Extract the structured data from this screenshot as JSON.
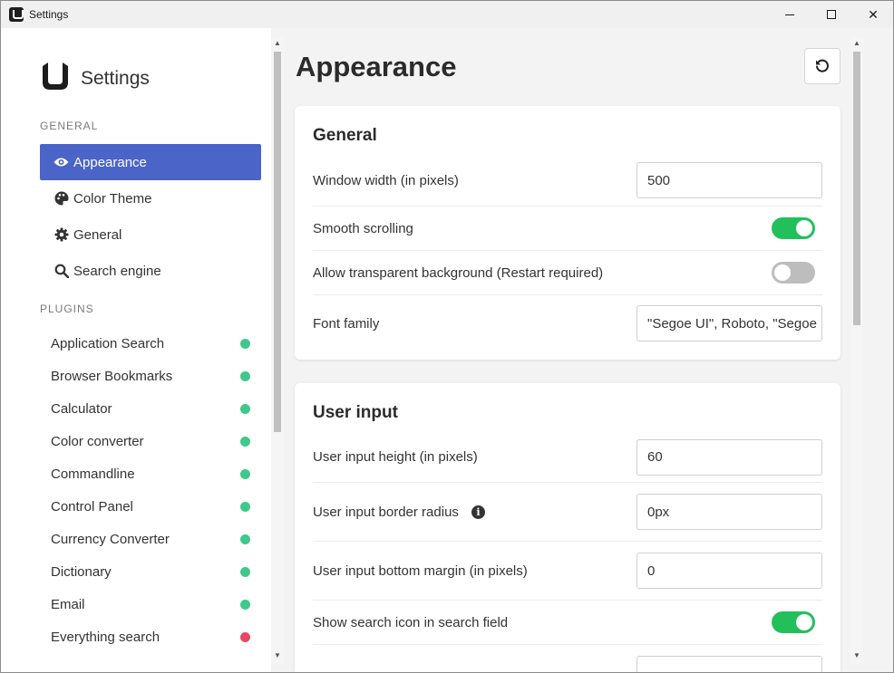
{
  "window": {
    "title": "Settings",
    "minimize_icon": "minimize-icon",
    "maximize_icon": "maximize-icon",
    "close_icon": "close-icon",
    "close_glyph": "✕"
  },
  "sidebar": {
    "brand_title": "Settings",
    "general_section": "GENERAL",
    "general_items": [
      {
        "label": "Appearance",
        "icon": "eye-icon",
        "active": true
      },
      {
        "label": "Color Theme",
        "icon": "palette-icon",
        "active": false
      },
      {
        "label": "General",
        "icon": "gear-icon",
        "active": false
      },
      {
        "label": "Search engine",
        "icon": "search-icon",
        "active": false
      }
    ],
    "plugins_section": "PLUGINS",
    "plugins": [
      {
        "label": "Application Search",
        "status": "enabled"
      },
      {
        "label": "Browser Bookmarks",
        "status": "enabled"
      },
      {
        "label": "Calculator",
        "status": "enabled"
      },
      {
        "label": "Color converter",
        "status": "enabled"
      },
      {
        "label": "Commandline",
        "status": "enabled"
      },
      {
        "label": "Control Panel",
        "status": "enabled"
      },
      {
        "label": "Currency Converter",
        "status": "enabled"
      },
      {
        "label": "Dictionary",
        "status": "enabled"
      },
      {
        "label": "Email",
        "status": "enabled"
      },
      {
        "label": "Everything search",
        "status": "disabled"
      }
    ]
  },
  "colors": {
    "accent": "#4b64c8",
    "toggle_on": "#22c05a",
    "toggle_off": "#bdbdbd",
    "status_enabled": "#3ec98a",
    "status_disabled": "#e8485e"
  },
  "main": {
    "page_title": "Appearance",
    "reset_icon": "reset-icon",
    "general_card": {
      "title": "General",
      "window_width_label": "Window width (in pixels)",
      "window_width_value": "500",
      "smooth_scrolling_label": "Smooth scrolling",
      "smooth_scrolling_on": true,
      "transparent_bg_label": "Allow transparent background (Restart required)",
      "transparent_bg_on": false,
      "font_family_label": "Font family",
      "font_family_value": "\"Segoe UI\", Roboto, \"Segoe"
    },
    "user_input_card": {
      "title": "User input",
      "height_label": "User input height (in pixels)",
      "height_value": "60",
      "border_radius_label": "User input border radius",
      "border_radius_value": "0px",
      "info_glyph": "i",
      "bottom_margin_label": "User input bottom margin (in pixels)",
      "bottom_margin_value": "0",
      "show_search_icon_label": "Show search icon in search field",
      "show_search_icon_on": true
    }
  }
}
